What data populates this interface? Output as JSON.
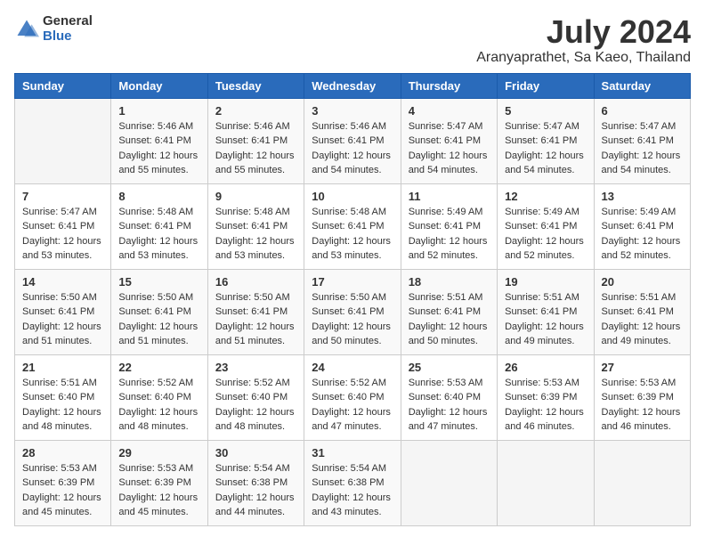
{
  "logo": {
    "general": "General",
    "blue": "Blue"
  },
  "title": {
    "month_year": "July 2024",
    "location": "Aranyaprathet, Sa Kaeo, Thailand"
  },
  "weekdays": [
    "Sunday",
    "Monday",
    "Tuesday",
    "Wednesday",
    "Thursday",
    "Friday",
    "Saturday"
  ],
  "weeks": [
    [
      {
        "day": "",
        "sunrise": "",
        "sunset": "",
        "daylight": "",
        "empty": true
      },
      {
        "day": "1",
        "sunrise": "Sunrise: 5:46 AM",
        "sunset": "Sunset: 6:41 PM",
        "daylight": "Daylight: 12 hours and 55 minutes."
      },
      {
        "day": "2",
        "sunrise": "Sunrise: 5:46 AM",
        "sunset": "Sunset: 6:41 PM",
        "daylight": "Daylight: 12 hours and 55 minutes."
      },
      {
        "day": "3",
        "sunrise": "Sunrise: 5:46 AM",
        "sunset": "Sunset: 6:41 PM",
        "daylight": "Daylight: 12 hours and 54 minutes."
      },
      {
        "day": "4",
        "sunrise": "Sunrise: 5:47 AM",
        "sunset": "Sunset: 6:41 PM",
        "daylight": "Daylight: 12 hours and 54 minutes."
      },
      {
        "day": "5",
        "sunrise": "Sunrise: 5:47 AM",
        "sunset": "Sunset: 6:41 PM",
        "daylight": "Daylight: 12 hours and 54 minutes."
      },
      {
        "day": "6",
        "sunrise": "Sunrise: 5:47 AM",
        "sunset": "Sunset: 6:41 PM",
        "daylight": "Daylight: 12 hours and 54 minutes."
      }
    ],
    [
      {
        "day": "7",
        "sunrise": "Sunrise: 5:47 AM",
        "sunset": "Sunset: 6:41 PM",
        "daylight": "Daylight: 12 hours and 53 minutes."
      },
      {
        "day": "8",
        "sunrise": "Sunrise: 5:48 AM",
        "sunset": "Sunset: 6:41 PM",
        "daylight": "Daylight: 12 hours and 53 minutes."
      },
      {
        "day": "9",
        "sunrise": "Sunrise: 5:48 AM",
        "sunset": "Sunset: 6:41 PM",
        "daylight": "Daylight: 12 hours and 53 minutes."
      },
      {
        "day": "10",
        "sunrise": "Sunrise: 5:48 AM",
        "sunset": "Sunset: 6:41 PM",
        "daylight": "Daylight: 12 hours and 53 minutes."
      },
      {
        "day": "11",
        "sunrise": "Sunrise: 5:49 AM",
        "sunset": "Sunset: 6:41 PM",
        "daylight": "Daylight: 12 hours and 52 minutes."
      },
      {
        "day": "12",
        "sunrise": "Sunrise: 5:49 AM",
        "sunset": "Sunset: 6:41 PM",
        "daylight": "Daylight: 12 hours and 52 minutes."
      },
      {
        "day": "13",
        "sunrise": "Sunrise: 5:49 AM",
        "sunset": "Sunset: 6:41 PM",
        "daylight": "Daylight: 12 hours and 52 minutes."
      }
    ],
    [
      {
        "day": "14",
        "sunrise": "Sunrise: 5:50 AM",
        "sunset": "Sunset: 6:41 PM",
        "daylight": "Daylight: 12 hours and 51 minutes."
      },
      {
        "day": "15",
        "sunrise": "Sunrise: 5:50 AM",
        "sunset": "Sunset: 6:41 PM",
        "daylight": "Daylight: 12 hours and 51 minutes."
      },
      {
        "day": "16",
        "sunrise": "Sunrise: 5:50 AM",
        "sunset": "Sunset: 6:41 PM",
        "daylight": "Daylight: 12 hours and 51 minutes."
      },
      {
        "day": "17",
        "sunrise": "Sunrise: 5:50 AM",
        "sunset": "Sunset: 6:41 PM",
        "daylight": "Daylight: 12 hours and 50 minutes."
      },
      {
        "day": "18",
        "sunrise": "Sunrise: 5:51 AM",
        "sunset": "Sunset: 6:41 PM",
        "daylight": "Daylight: 12 hours and 50 minutes."
      },
      {
        "day": "19",
        "sunrise": "Sunrise: 5:51 AM",
        "sunset": "Sunset: 6:41 PM",
        "daylight": "Daylight: 12 hours and 49 minutes."
      },
      {
        "day": "20",
        "sunrise": "Sunrise: 5:51 AM",
        "sunset": "Sunset: 6:41 PM",
        "daylight": "Daylight: 12 hours and 49 minutes."
      }
    ],
    [
      {
        "day": "21",
        "sunrise": "Sunrise: 5:51 AM",
        "sunset": "Sunset: 6:40 PM",
        "daylight": "Daylight: 12 hours and 48 minutes."
      },
      {
        "day": "22",
        "sunrise": "Sunrise: 5:52 AM",
        "sunset": "Sunset: 6:40 PM",
        "daylight": "Daylight: 12 hours and 48 minutes."
      },
      {
        "day": "23",
        "sunrise": "Sunrise: 5:52 AM",
        "sunset": "Sunset: 6:40 PM",
        "daylight": "Daylight: 12 hours and 48 minutes."
      },
      {
        "day": "24",
        "sunrise": "Sunrise: 5:52 AM",
        "sunset": "Sunset: 6:40 PM",
        "daylight": "Daylight: 12 hours and 47 minutes."
      },
      {
        "day": "25",
        "sunrise": "Sunrise: 5:53 AM",
        "sunset": "Sunset: 6:40 PM",
        "daylight": "Daylight: 12 hours and 47 minutes."
      },
      {
        "day": "26",
        "sunrise": "Sunrise: 5:53 AM",
        "sunset": "Sunset: 6:39 PM",
        "daylight": "Daylight: 12 hours and 46 minutes."
      },
      {
        "day": "27",
        "sunrise": "Sunrise: 5:53 AM",
        "sunset": "Sunset: 6:39 PM",
        "daylight": "Daylight: 12 hours and 46 minutes."
      }
    ],
    [
      {
        "day": "28",
        "sunrise": "Sunrise: 5:53 AM",
        "sunset": "Sunset: 6:39 PM",
        "daylight": "Daylight: 12 hours and 45 minutes."
      },
      {
        "day": "29",
        "sunrise": "Sunrise: 5:53 AM",
        "sunset": "Sunset: 6:39 PM",
        "daylight": "Daylight: 12 hours and 45 minutes."
      },
      {
        "day": "30",
        "sunrise": "Sunrise: 5:54 AM",
        "sunset": "Sunset: 6:38 PM",
        "daylight": "Daylight: 12 hours and 44 minutes."
      },
      {
        "day": "31",
        "sunrise": "Sunrise: 5:54 AM",
        "sunset": "Sunset: 6:38 PM",
        "daylight": "Daylight: 12 hours and 43 minutes."
      },
      {
        "day": "",
        "sunrise": "",
        "sunset": "",
        "daylight": "",
        "empty": true
      },
      {
        "day": "",
        "sunrise": "",
        "sunset": "",
        "daylight": "",
        "empty": true
      },
      {
        "day": "",
        "sunrise": "",
        "sunset": "",
        "daylight": "",
        "empty": true
      }
    ]
  ]
}
